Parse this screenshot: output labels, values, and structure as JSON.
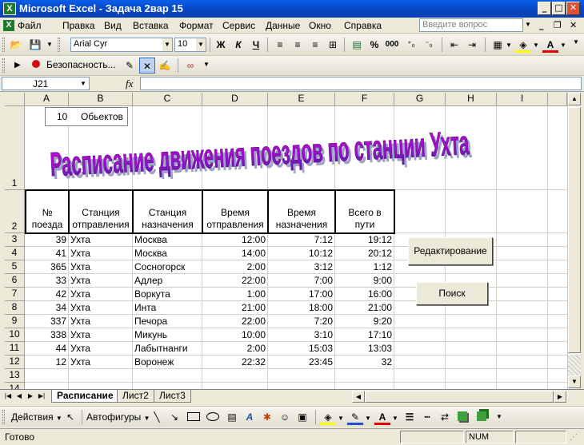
{
  "window": {
    "title": "Microsoft Excel - Задача 2вар 15"
  },
  "menu": {
    "items": [
      "Файл",
      "Правка",
      "Вид",
      "Вставка",
      "Формат",
      "Сервис",
      "Данные",
      "Окно",
      "Справка"
    ],
    "help_placeholder": "Введите вопрос"
  },
  "toolbar": {
    "font_name": "Arial Cyr",
    "font_size": "10",
    "bold": "Ж",
    "italic": "К",
    "underline": "Ч",
    "percent": "%",
    "thousands": "000",
    "security": "Безопасность..."
  },
  "formula_bar": {
    "name_box": "J21",
    "fx": "fx",
    "value": ""
  },
  "columns": [
    "A",
    "B",
    "C",
    "D",
    "E",
    "F",
    "G",
    "H",
    "I"
  ],
  "rows": [
    "1",
    "2",
    "3",
    "4",
    "5",
    "6",
    "7",
    "8",
    "9",
    "10",
    "11",
    "12",
    "13",
    "14"
  ],
  "counter": {
    "value": "10",
    "label": "Обьектов"
  },
  "wordart_title": "Расписание движения поездов по станции Ухта",
  "table": {
    "headers": [
      [
        "№",
        "поезда"
      ],
      [
        "Станция",
        "отправления"
      ],
      [
        "Станция",
        "назначения"
      ],
      [
        "Время",
        "отправления"
      ],
      [
        "Время",
        "назначения"
      ],
      [
        "Всего в",
        "пути"
      ]
    ],
    "rows": [
      [
        "39",
        "Ухта",
        "Москва",
        "12:00",
        "7:12",
        "19:12"
      ],
      [
        "41",
        "Ухта",
        "Москва",
        "14:00",
        "10:12",
        "20:12"
      ],
      [
        "365",
        "Ухта",
        "Сосногорск",
        "2:00",
        "3:12",
        "1:12"
      ],
      [
        "33",
        "Ухта",
        "Адлер",
        "22:00",
        "7:00",
        "9:00"
      ],
      [
        "42",
        "Ухта",
        "Воркута",
        "1:00",
        "17:00",
        "16:00"
      ],
      [
        "34",
        "Ухта",
        "Инта",
        "21:00",
        "18:00",
        "21:00"
      ],
      [
        "337",
        "Ухта",
        "Печора",
        "22:00",
        "7:20",
        "9:20"
      ],
      [
        "338",
        "Ухта",
        "Микунь",
        "10:00",
        "3:10",
        "17:10"
      ],
      [
        "44",
        "Ухта",
        "Лабытнанги",
        "2:00",
        "15:03",
        "13:03"
      ],
      [
        "12",
        "Ухта",
        "Воронеж",
        "22:32",
        "23:45",
        "32"
      ]
    ]
  },
  "buttons": {
    "edit": "Редактирование",
    "search": "Поиск"
  },
  "sheets": [
    "Расписание",
    "Лист2",
    "Лист3"
  ],
  "draw_toolbar": {
    "actions": "Действия",
    "autoshapes": "Автофигуры"
  },
  "status": {
    "ready": "Готово",
    "num": "NUM"
  }
}
